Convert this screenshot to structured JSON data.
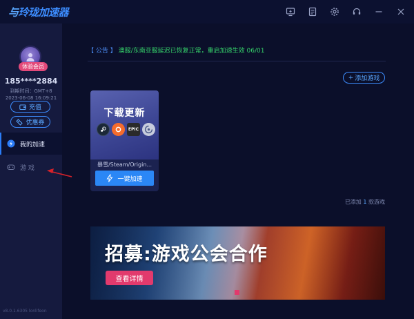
{
  "app": {
    "logo_text": "玲珑加速器"
  },
  "titlebar": {
    "icons": [
      "screen-icon",
      "document-icon",
      "gear-icon",
      "headset-icon",
      "minimize-icon",
      "close-icon"
    ]
  },
  "sidebar": {
    "avatar_icon": "user-avatar-icon",
    "member_badge": "体验会员",
    "user_id": "185****2884",
    "expire_label": "到期时间：GMT+8",
    "expire_time": "2023-06-08 16:09:21",
    "recharge_label": "充值",
    "coupon_label": "优惠券",
    "nav": [
      {
        "label": "我的加速",
        "icon": "speed-icon",
        "active": true
      },
      {
        "label": "游 戏",
        "icon": "gamepad-icon",
        "active": false
      }
    ],
    "version": "v8.0.1.6305 lonlifeon"
  },
  "notice": {
    "tag": "【 公告 】",
    "message": "澳服/东南亚服延迟已恢复正常，重启加速生效 06/01"
  },
  "add_game_label": "添加游戏",
  "game_card": {
    "cover_title": "下载更新",
    "launchers": [
      "steam-icon",
      "origin-icon",
      "epic-icon",
      "ubisoft-icon"
    ],
    "epic_text": "EPIC",
    "name": "暴雪/Steam/Origin...",
    "accel_label": "一键加速"
  },
  "count_line": {
    "prefix": "已添加",
    "count": "1",
    "suffix": "款游戏"
  },
  "banner": {
    "title": "招募:游戏公会合作",
    "button_label": "查看详情"
  },
  "colors": {
    "accent": "#2b87f6",
    "notice_green": "#35d06a",
    "badge_pink": "#e23a6d",
    "annotation_arrow": "#d8222a"
  }
}
